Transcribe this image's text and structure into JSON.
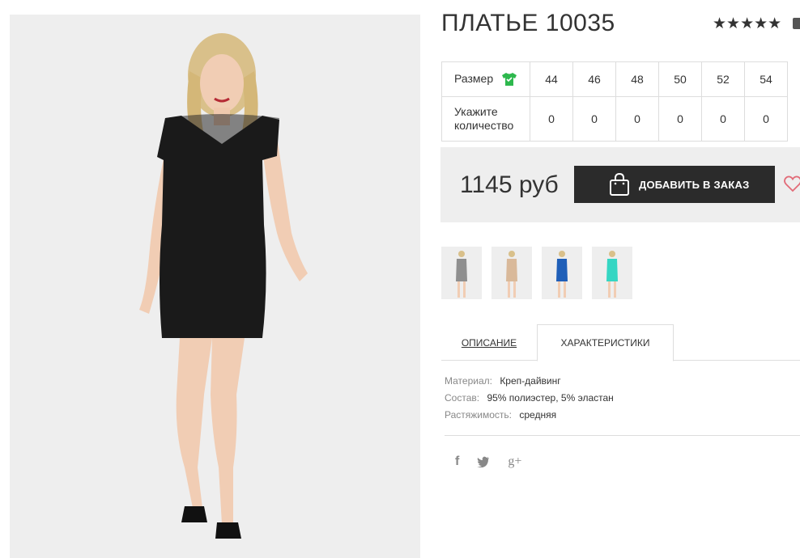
{
  "product": {
    "title": "ПЛАТЬЕ 10035",
    "rating_stars": "★★★★★",
    "rating_value": 5
  },
  "sizes": {
    "size_label": "Размер",
    "quantity_label_line1": "Укажите",
    "quantity_label_line2": "количество",
    "values": [
      "44",
      "46",
      "48",
      "50",
      "52",
      "54"
    ],
    "quantities": [
      "0",
      "0",
      "0",
      "0",
      "0",
      "0"
    ],
    "icon": "tshirt-icon",
    "icon_color": "#2db84d"
  },
  "price": {
    "amount": "1145 руб",
    "add_button_label": "ДОБАВИТЬ В ЗАКАЗ",
    "button_color": "#2b2b2b",
    "heart_color": "#e26b78"
  },
  "thumbnails": [
    {
      "color_name": "gray",
      "color": "#8f8f8f"
    },
    {
      "color_name": "beige",
      "color": "#d9b99a"
    },
    {
      "color_name": "blue",
      "color": "#1f5fb8"
    },
    {
      "color_name": "turquoise",
      "color": "#35d6c3"
    }
  ],
  "tabs": {
    "description": "ОПИСАНИЕ",
    "characteristics": "ХАРАКТЕРИСТИКИ",
    "active": "characteristics"
  },
  "characteristics": {
    "material_key": "Материал:",
    "material_val": "Креп-дайвинг",
    "composition_key": "Состав:",
    "composition_val": "95% полиэстер, 5% эластан",
    "stretch_key": "Растяжимость:",
    "stretch_val": "средняя"
  },
  "social": {
    "facebook": "f",
    "twitter": "twitter-icon",
    "googleplus": "g+"
  }
}
